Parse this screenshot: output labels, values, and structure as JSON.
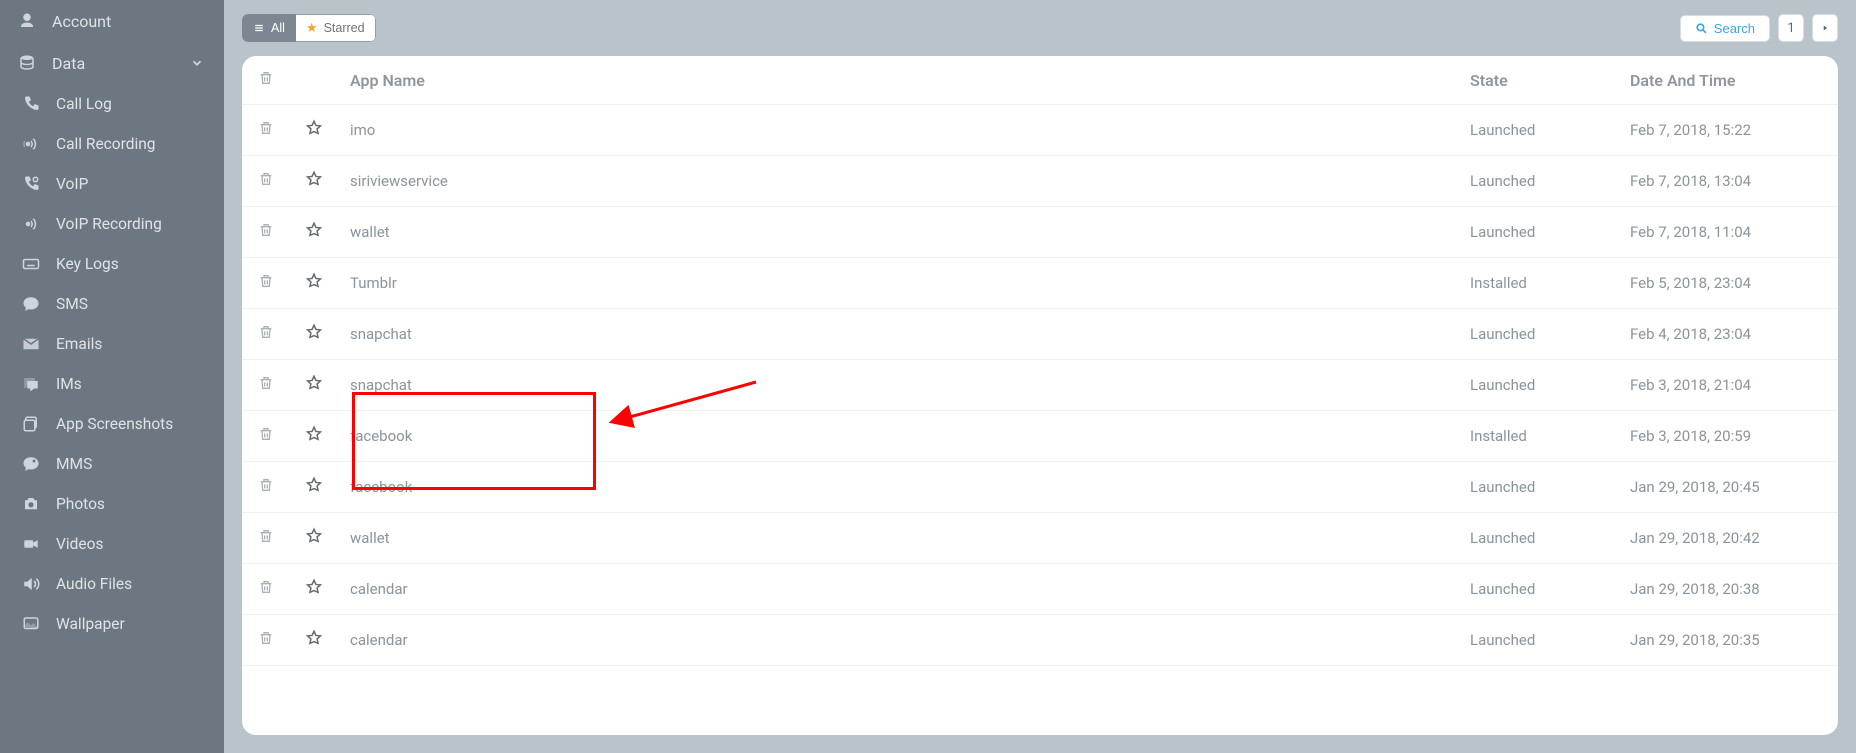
{
  "sidebar": {
    "account_label": "Account",
    "data_label": "Data",
    "items": [
      {
        "label": "Call Log",
        "icon": "phone"
      },
      {
        "label": "Call Recording",
        "icon": "broadcast"
      },
      {
        "label": "VoIP",
        "icon": "voip"
      },
      {
        "label": "VoIP Recording",
        "icon": "voip-rec"
      },
      {
        "label": "Key Logs",
        "icon": "keyboard"
      },
      {
        "label": "SMS",
        "icon": "chat"
      },
      {
        "label": "Emails",
        "icon": "mail"
      },
      {
        "label": "IMs",
        "icon": "ims"
      },
      {
        "label": "App Screenshots",
        "icon": "screenshots"
      },
      {
        "label": "MMS",
        "icon": "mms"
      },
      {
        "label": "Photos",
        "icon": "camera"
      },
      {
        "label": "Videos",
        "icon": "video"
      },
      {
        "label": "Audio Files",
        "icon": "audio"
      },
      {
        "label": "Wallpaper",
        "icon": "wallpaper"
      }
    ]
  },
  "toolbar": {
    "all_label": "All",
    "starred_label": "Starred",
    "search_label": "Search",
    "page": "1"
  },
  "table": {
    "headers": {
      "name": "App Name",
      "state": "State",
      "date": "Date And Time"
    },
    "rows": [
      {
        "name": "imo",
        "state": "Launched",
        "date": "Feb 7, 2018, 15:22"
      },
      {
        "name": "siriviewservice",
        "state": "Launched",
        "date": "Feb 7, 2018, 13:04"
      },
      {
        "name": "wallet",
        "state": "Launched",
        "date": "Feb 7, 2018, 11:04"
      },
      {
        "name": "Tumblr",
        "state": "Installed",
        "date": "Feb 5, 2018, 23:04"
      },
      {
        "name": "snapchat",
        "state": "Launched",
        "date": "Feb 4, 2018, 23:04"
      },
      {
        "name": "snapchat",
        "state": "Launched",
        "date": "Feb 3, 2018, 21:04"
      },
      {
        "name": "facebook",
        "state": "Installed",
        "date": "Feb 3, 2018, 20:59"
      },
      {
        "name": "facebook",
        "state": "Launched",
        "date": "Jan 29, 2018, 20:45"
      },
      {
        "name": "wallet",
        "state": "Launched",
        "date": "Jan 29, 2018, 20:42"
      },
      {
        "name": "calendar",
        "state": "Launched",
        "date": "Jan 29, 2018, 20:38"
      },
      {
        "name": "calendar",
        "state": "Launched",
        "date": "Jan 29, 2018, 20:35"
      }
    ]
  }
}
